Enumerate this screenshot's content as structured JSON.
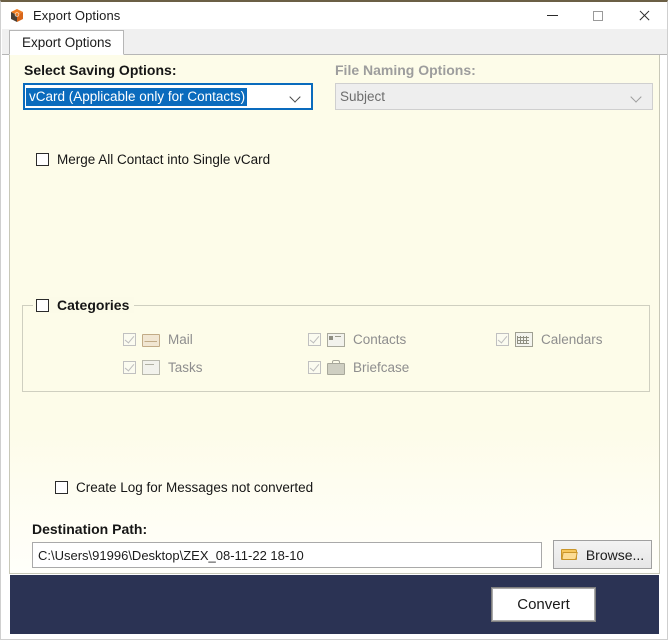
{
  "window": {
    "title": "Export Options",
    "icon": "app-cube-icon",
    "controls": {
      "minimize": "minimize-icon",
      "maximize": "maximize-icon",
      "close": "close-icon"
    }
  },
  "tabs": [
    {
      "label": "Export Options",
      "active": true
    }
  ],
  "saving": {
    "label": "Select Saving Options:",
    "selected": "vCard (Applicable only for Contacts)",
    "options": [
      "vCard (Applicable only for Contacts)"
    ]
  },
  "file_naming": {
    "label": "File Naming Options:",
    "selected": "Subject",
    "disabled": true,
    "options": [
      "Subject"
    ]
  },
  "merge_option": {
    "label": "Merge All Contact into Single vCard",
    "checked": false
  },
  "categories": {
    "legend": "Categories",
    "checked": false,
    "items": [
      {
        "label": "Mail",
        "icon": "mail-icon",
        "checked": true,
        "disabled": true
      },
      {
        "label": "Contacts",
        "icon": "contacts-icon",
        "checked": true,
        "disabled": true
      },
      {
        "label": "Calendars",
        "icon": "calendars-icon",
        "checked": true,
        "disabled": true
      },
      {
        "label": "Tasks",
        "icon": "tasks-icon",
        "checked": true,
        "disabled": true
      },
      {
        "label": "Briefcase",
        "icon": "briefcase-icon",
        "checked": true,
        "disabled": true
      }
    ]
  },
  "create_log": {
    "label": "Create Log for Messages not converted",
    "checked": false
  },
  "destination": {
    "label": "Destination Path:",
    "value": "C:\\Users\\91996\\Desktop\\ZEX_08-11-22 18-10",
    "browse_label": "Browse...",
    "browse_icon": "folder-icon"
  },
  "footer": {
    "convert_label": "Convert"
  },
  "colors": {
    "panel_bg": "#fcfbe8",
    "footer_bg": "#2b3354",
    "accent_blue": "#0a6bbd",
    "titlebar_top_border": "#6b5f45"
  }
}
